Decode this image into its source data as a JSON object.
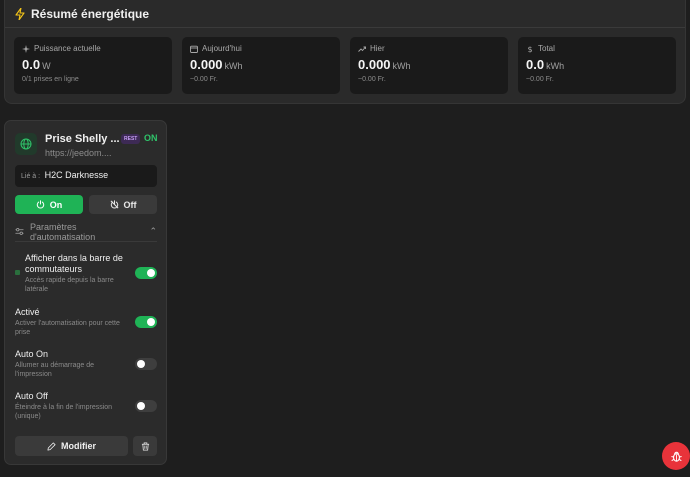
{
  "energy": {
    "title": "Résumé énergétique",
    "accent": "#f5c518",
    "stats": [
      {
        "label": "Puissance actuelle",
        "value": "0.0",
        "unit": "W",
        "sub": "0/1 prises en ligne",
        "icon": "sparkle-icon"
      },
      {
        "label": "Aujourd'hui",
        "value": "0.000",
        "unit": "kWh",
        "sub": "~0.00 Fr.",
        "icon": "calendar-icon"
      },
      {
        "label": "Hier",
        "value": "0.000",
        "unit": "kWh",
        "sub": "~0.00 Fr.",
        "icon": "trend-icon"
      },
      {
        "label": "Total",
        "value": "0.0",
        "unit": "kWh",
        "sub": "~0.00 Fr.",
        "icon": "dollar-icon"
      }
    ]
  },
  "device": {
    "name": "Prise Shelly ...",
    "url": "https://jeedom....",
    "badge": "REST",
    "status": "ON",
    "linked_label": "Lié à :",
    "linked_value": "H2C Darknesse",
    "on_label": "On",
    "off_label": "Off",
    "automation_label": "Paramètres d'automatisation",
    "automation_chevron": "⌃",
    "settings": [
      {
        "title": "Afficher dans la barre de commutateurs",
        "desc": "Accès rapide depuis la barre latérale",
        "enabled": true
      },
      {
        "title": "Activé",
        "desc": "Activer l'automatisation pour cette prise",
        "enabled": true
      },
      {
        "title": "Auto On",
        "desc": "Allumer au démarrage de l'impression",
        "enabled": false
      },
      {
        "title": "Auto Off",
        "desc": "Éteindre à la fin de l'impression (unique)",
        "enabled": false
      }
    ],
    "modify_label": "Modifier"
  },
  "colors": {
    "green": "#1fb356",
    "red": "#e8333a",
    "purple_badge": "#c79df5"
  }
}
